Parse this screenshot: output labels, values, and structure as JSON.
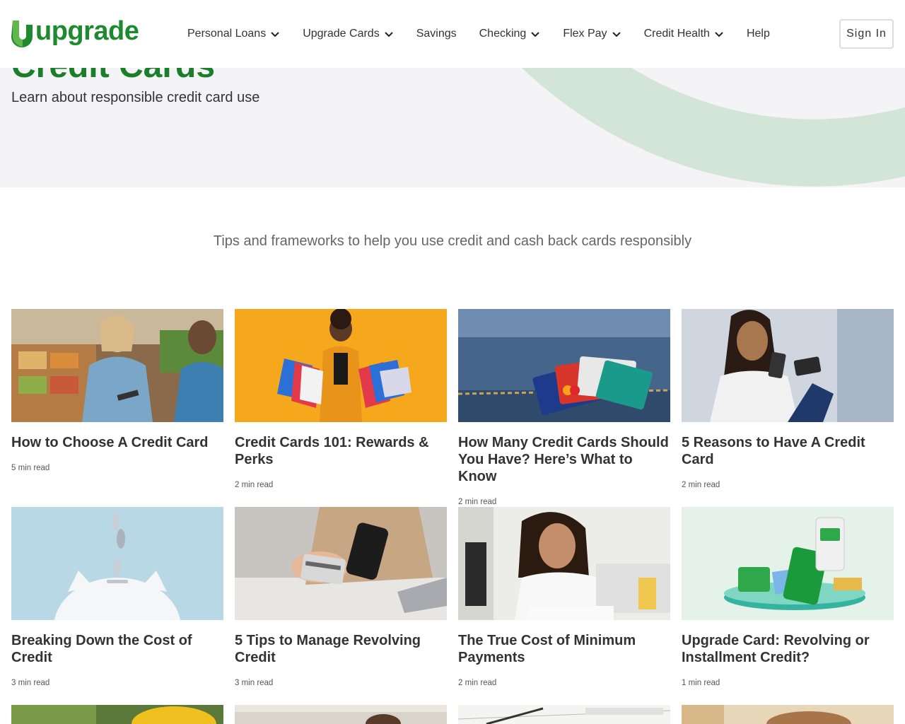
{
  "brand": {
    "name": "upgrade",
    "logo_color": "#1e8a2f"
  },
  "nav": {
    "items": [
      {
        "label": "Personal Loans",
        "dropdown": true
      },
      {
        "label": "Upgrade Cards",
        "dropdown": true
      },
      {
        "label": "Savings",
        "dropdown": false
      },
      {
        "label": "Checking",
        "dropdown": true
      },
      {
        "label": "Flex Pay",
        "dropdown": true
      },
      {
        "label": "Credit Health",
        "dropdown": true
      },
      {
        "label": "Help",
        "dropdown": false
      }
    ],
    "signin_label": "Sign In"
  },
  "hero": {
    "title": "Credit Cards",
    "subtitle": "Learn about responsible credit card use"
  },
  "tagline": "Tips and frameworks to help you use credit and cash back cards responsibly",
  "articles": [
    {
      "title": "How to Choose A Credit Card",
      "read_time": "5 min read"
    },
    {
      "title": "Credit Cards 101: Rewards & Perks",
      "read_time": "2 min read"
    },
    {
      "title": "How Many Credit Cards Should You Have? Here’s What to Know",
      "read_time": "2 min read"
    },
    {
      "title": "5 Reasons to Have A Credit Card",
      "read_time": "2 min read"
    },
    {
      "title": "Breaking Down the Cost of Credit",
      "read_time": "3 min read"
    },
    {
      "title": "5 Tips to Manage Revolving Credit",
      "read_time": "3 min read"
    },
    {
      "title": "The True Cost of Minimum Payments",
      "read_time": "2 min read"
    },
    {
      "title": "Upgrade Card: Revolving or Installment Credit?",
      "read_time": "1 min read"
    }
  ],
  "colors": {
    "accent": "#1e8a2f",
    "hero_bg": "#f4f4f6",
    "hero_arc": "#d3e5d6"
  }
}
